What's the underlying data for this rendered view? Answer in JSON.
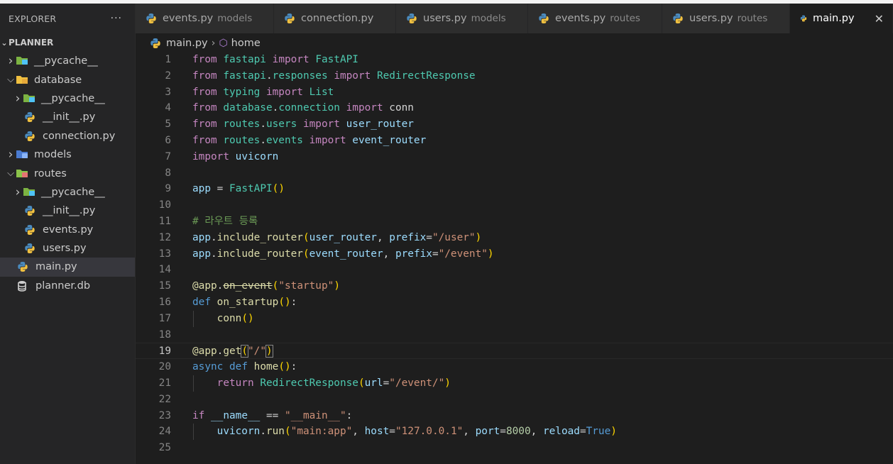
{
  "explorer": {
    "title": "EXPLORER",
    "more": "···",
    "project": "PLANNER",
    "items": [
      {
        "label": "__pycache__",
        "type": "folder-pycache",
        "expanded": false,
        "indent": 1
      },
      {
        "label": "database",
        "type": "folder-db",
        "expanded": true,
        "indent": 1
      },
      {
        "label": "__pycache__",
        "type": "folder-pycache",
        "expanded": false,
        "indent": 2
      },
      {
        "label": "__init__.py",
        "type": "python",
        "indent": 2
      },
      {
        "label": "connection.py",
        "type": "python",
        "indent": 2
      },
      {
        "label": "models",
        "type": "folder-models",
        "expanded": false,
        "indent": 1
      },
      {
        "label": "routes",
        "type": "folder-routes",
        "expanded": true,
        "indent": 1
      },
      {
        "label": "__pycache__",
        "type": "folder-pycache",
        "expanded": false,
        "indent": 2
      },
      {
        "label": "__init__.py",
        "type": "python",
        "indent": 2
      },
      {
        "label": "events.py",
        "type": "python",
        "indent": 2
      },
      {
        "label": "users.py",
        "type": "python",
        "indent": 2
      },
      {
        "label": "main.py",
        "type": "python",
        "indent": 1,
        "active": true
      },
      {
        "label": "planner.db",
        "type": "database",
        "indent": 1
      }
    ]
  },
  "tabs": [
    {
      "label": "events.py",
      "desc": "models",
      "width": 195
    },
    {
      "label": "connection.py",
      "desc": "",
      "width": 172
    },
    {
      "label": "users.py",
      "desc": "models",
      "width": 186
    },
    {
      "label": "events.py",
      "desc": "routes",
      "width": 189
    },
    {
      "label": "users.py",
      "desc": "routes",
      "width": 180
    },
    {
      "label": "main.py",
      "desc": "",
      "width": 145,
      "active": true,
      "close": "✕"
    }
  ],
  "breadcrumb": {
    "file": "main.py",
    "separator": "›",
    "symbol": "home"
  },
  "editor": {
    "current_line": 19,
    "lines": [
      {
        "n": "1",
        "code": "from fastapi import FastAPI"
      },
      {
        "n": "2",
        "code": "from fastapi.responses import RedirectResponse"
      },
      {
        "n": "3",
        "code": "from typing import List"
      },
      {
        "n": "4",
        "code": "from database.connection import conn"
      },
      {
        "n": "5",
        "code": "from routes.users import user_router"
      },
      {
        "n": "6",
        "code": "from routes.events import event_router"
      },
      {
        "n": "7",
        "code": "import uvicorn"
      },
      {
        "n": "8",
        "code": ""
      },
      {
        "n": "9",
        "code": "app = FastAPI()"
      },
      {
        "n": "10",
        "code": ""
      },
      {
        "n": "11",
        "code": "# 라우트 등록"
      },
      {
        "n": "12",
        "code": "app.include_router(user_router, prefix=\"/user\")"
      },
      {
        "n": "13",
        "code": "app.include_router(event_router, prefix=\"/event\")"
      },
      {
        "n": "14",
        "code": ""
      },
      {
        "n": "15",
        "code": "@app.on_event(\"startup\")"
      },
      {
        "n": "16",
        "code": "def on_startup():"
      },
      {
        "n": "17",
        "code": "    conn()"
      },
      {
        "n": "18",
        "code": ""
      },
      {
        "n": "19",
        "code": "@app.get(\"/\")"
      },
      {
        "n": "20",
        "code": "async def home():"
      },
      {
        "n": "21",
        "code": "    return RedirectResponse(url=\"/event/\")"
      },
      {
        "n": "22",
        "code": ""
      },
      {
        "n": "23",
        "code": "if __name__ == \"__main__\":"
      },
      {
        "n": "24",
        "code": "    uvicorn.run(\"main:app\", host=\"127.0.0.1\", port=8000, reload=True)"
      },
      {
        "n": "25",
        "code": ""
      }
    ]
  },
  "colors": {
    "keyword": "#c586c0",
    "builtin": "#569cd6",
    "module": "#4ec9b0",
    "function": "#dcdcaa",
    "string": "#ce9178",
    "variable": "#9cdcfe",
    "comment": "#6a9955",
    "number": "#b5cea8",
    "bracket1": "#ffd700",
    "bracket2": "#da70d6"
  }
}
